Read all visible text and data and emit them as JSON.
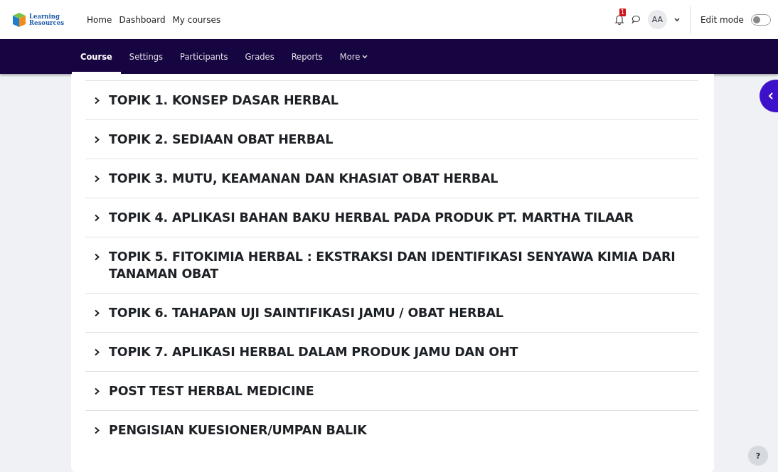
{
  "logo": {
    "line_1": "Learning",
    "line_2": "Resources"
  },
  "primary_nav": [
    {
      "label": "Home"
    },
    {
      "label": "Dashboard"
    },
    {
      "label": "My courses"
    }
  ],
  "notifications": {
    "count": "1"
  },
  "user_menu": {
    "initials": "AA"
  },
  "edit_mode": {
    "label": "Edit mode",
    "on": false
  },
  "secondary_nav": [
    {
      "label": "Course",
      "selected": true,
      "kind": "tab"
    },
    {
      "label": "Settings",
      "selected": false,
      "kind": "tab"
    },
    {
      "label": "Participants",
      "selected": false,
      "kind": "tab"
    },
    {
      "label": "Grades",
      "selected": false,
      "kind": "tab"
    },
    {
      "label": "Reports",
      "selected": false,
      "kind": "tab"
    },
    {
      "label": "More",
      "selected": false,
      "kind": "dropdown"
    }
  ],
  "sections": [
    {
      "title": "TOPIK 1. KONSEP DASAR HERBAL",
      "expanded": false
    },
    {
      "title": "TOPIK 2. SEDIAAN OBAT HERBAL",
      "expanded": false
    },
    {
      "title": "TOPIK 3. MUTU, KEAMANAN DAN KHASIAT OBAT HERBAL",
      "expanded": false
    },
    {
      "title": "TOPIK 4. APLIKASI BAHAN BAKU HERBAL PADA PRODUK PT. MARTHA TILAAR",
      "expanded": false
    },
    {
      "title": "TOPIK 5. FITOKIMIA HERBAL : EKSTRAKSI DAN IDENTIFIKASI SENYAWA KIMIA DARI TANAMAN OBAT",
      "expanded": false
    },
    {
      "title": "TOPIK 6. TAHAPAN UJI SAINTIFIKASI JAMU / OBAT HERBAL",
      "expanded": false
    },
    {
      "title": "TOPIK 7. APLIKASI HERBAL DALAM PRODUK JAMU DAN OHT",
      "expanded": false
    },
    {
      "title": "POST TEST HERBAL MEDICINE",
      "expanded": false
    },
    {
      "title": "PENGISIAN KUESIONER/UMPAN BALIK",
      "expanded": false
    }
  ],
  "help_button": {
    "label": "?"
  }
}
